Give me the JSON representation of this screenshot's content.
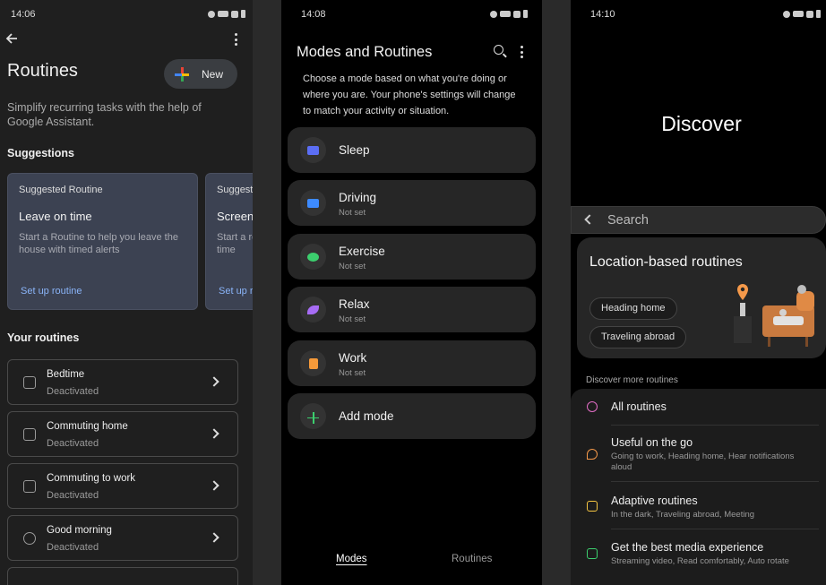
{
  "panel1": {
    "status_time": "14:06",
    "title": "Routines",
    "new_label": "New",
    "subtitle": "Simplify recurring tasks with the help of Google Assistant.",
    "suggestions_heading": "Suggestions",
    "suggestions": [
      {
        "label": "Suggested Routine",
        "title": "Leave on time",
        "desc": "Start a Routine to help you leave the house with timed alerts",
        "link": "Set up routine"
      },
      {
        "label": "Suggested Routine",
        "title": "Screen time",
        "desc": "Start a routine to help reduce screen time",
        "link": "Set up routine"
      }
    ],
    "your_routines_heading": "Your routines",
    "routines": [
      {
        "name": "Bedtime",
        "status": "Deactivated",
        "icon": "bed-icon"
      },
      {
        "name": "Commuting home",
        "status": "Deactivated",
        "icon": "car-icon"
      },
      {
        "name": "Commuting to work",
        "status": "Deactivated",
        "icon": "car-icon"
      },
      {
        "name": "Good morning",
        "status": "Deactivated",
        "icon": "sun-icon"
      }
    ]
  },
  "panel2": {
    "status_time": "14:08",
    "title": "Modes and Routines",
    "description": "Choose a mode based on what you're doing or where you are. Your phone's settings will change to match your activity or situation.",
    "modes": [
      {
        "name": "Sleep",
        "status": "",
        "color": "#5b6ef5"
      },
      {
        "name": "Driving",
        "status": "Not set",
        "color": "#3d8bff"
      },
      {
        "name": "Exercise",
        "status": "Not set",
        "color": "#3ccf6e"
      },
      {
        "name": "Relax",
        "status": "Not set",
        "color": "#a76cf5"
      },
      {
        "name": "Work",
        "status": "Not set",
        "color": "#f59a3a"
      }
    ],
    "add_mode": "Add mode",
    "tabs": {
      "modes": "Modes",
      "routines": "Routines"
    }
  },
  "panel3": {
    "status_time": "14:10",
    "title": "Discover",
    "search_label": "Search",
    "location_card": {
      "title": "Location-based routines",
      "chips": [
        "Heading home",
        "Traveling abroad"
      ]
    },
    "more_label": "Discover more routines",
    "items": [
      {
        "name": "All routines",
        "sub": "",
        "color": "#e06cc4"
      },
      {
        "name": "Useful on the go",
        "sub": "Going to work, Heading home, Hear notifications aloud",
        "color": "#f5994a"
      },
      {
        "name": "Adaptive routines",
        "sub": "In the dark, Traveling abroad, Meeting",
        "color": "#f5c542"
      },
      {
        "name": "Get the best media experience",
        "sub": "Streaming video, Read comfortably, Auto rotate",
        "color": "#3ccf6e"
      }
    ]
  }
}
